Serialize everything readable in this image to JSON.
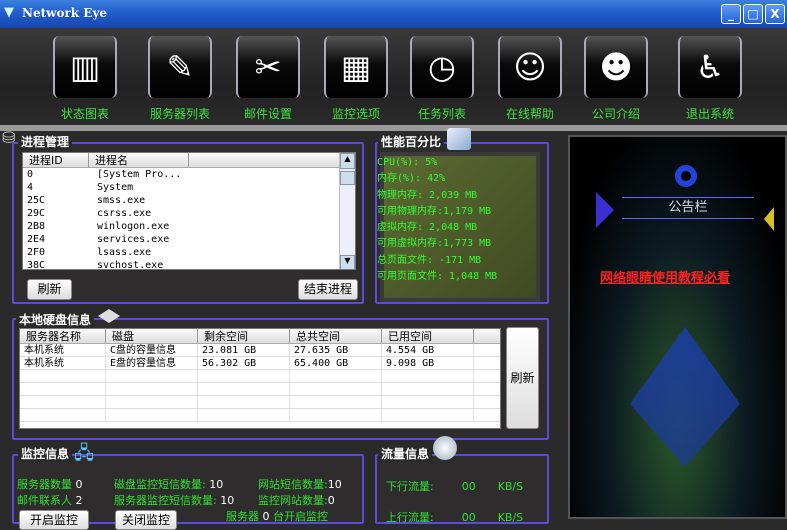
{
  "window": {
    "title": "Network Eye",
    "min": "_",
    "max": "□",
    "close": "X"
  },
  "toolbar": [
    {
      "label": "状态图表",
      "icon": "bar-chart-icon",
      "glyph": "▥"
    },
    {
      "label": "服务器列表",
      "icon": "drafting-tools-icon",
      "glyph": "✎"
    },
    {
      "label": "邮件设置",
      "icon": "tools-icon",
      "glyph": "✂"
    },
    {
      "label": "监控选项",
      "icon": "calendar-icon",
      "glyph": "▦"
    },
    {
      "label": "任务列表",
      "icon": "clock-icon",
      "glyph": "◷"
    },
    {
      "label": "在线帮助",
      "icon": "users-icon",
      "glyph": "☺"
    },
    {
      "label": "公司介绍",
      "icon": "chat-icon",
      "glyph": "☻"
    },
    {
      "label": "退出系统",
      "icon": "exit-runner-icon",
      "glyph": "♿"
    }
  ],
  "process": {
    "title": "进程管理",
    "columns": [
      "进程ID",
      "进程名",
      ""
    ],
    "rows": [
      [
        "0",
        "[System Pro..."
      ],
      [
        "4",
        "System"
      ],
      [
        "25C",
        "smss.exe"
      ],
      [
        "29C",
        "csrss.exe"
      ],
      [
        "2B8",
        "winlogon.exe"
      ],
      [
        "2E4",
        "services.exe"
      ],
      [
        "2F0",
        "lsass.exe"
      ],
      [
        "38C",
        "svchost.exe"
      ]
    ],
    "refresh": "刷新",
    "end": "结束进程"
  },
  "perf": {
    "title": "性能百分比",
    "lines": [
      "CPU(%):  5%",
      "内存(%):    42%",
      "物理内存: 2,039 MB",
      "可用物理内存:1,179 MB",
      "虚拟内存: 2,048 MB",
      "可用虚拟内存:1,773 MB",
      "总页面文件:  -171 MB",
      "可用页面文件: 1,048 MB"
    ]
  },
  "notice": {
    "title": "公告栏",
    "link": "网络眼睛使用教程必看"
  },
  "disk": {
    "title": "本地硬盘信息",
    "columns": [
      "服务器名称",
      "磁盘",
      "剩余空间",
      "总共空间",
      "已用空间"
    ],
    "rows": [
      [
        "本机系统",
        "C盘的容量信息",
        "23.081 GB",
        "27.635 GB",
        "4.554 GB"
      ],
      [
        "本机系统",
        "E盘的容量信息",
        "56.302 GB",
        "65.400 GB",
        "9.098 GB"
      ]
    ],
    "refresh": "刷新"
  },
  "monitor": {
    "title": "监控信息",
    "server_count_label": "服务器数量",
    "server_count": "0",
    "mail_contacts_label": "邮件联系人",
    "mail_contacts": "2",
    "disk_sms_label": "磁盘监控短信数量:",
    "disk_sms": "10",
    "server_sms_label": "服务器监控短信数量:",
    "server_sms": "10",
    "site_sms_label": "网站短信数量:",
    "site_sms": "10",
    "site_count_label": "监控网站数量:",
    "site_count": "0",
    "server_on_prefix": "服务器",
    "server_on": "0",
    "server_on_suffix": "台开启监控",
    "start": "开启监控",
    "stop": "关闭监控"
  },
  "traffic": {
    "title": "流量信息",
    "down_label": "下行流量:",
    "down": "00",
    "up_label": "上行流量:",
    "up": "00",
    "unit": "KB/S"
  }
}
